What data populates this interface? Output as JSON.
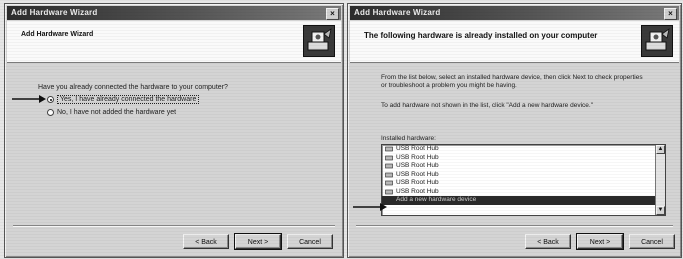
{
  "window_left": {
    "title": "Add Hardware Wizard",
    "header_text": "Add Hardware Wizard",
    "question": "Have you already connected the hardware to your computer?",
    "options": [
      {
        "label": "Yes, I have already connected the hardware",
        "selected": true
      },
      {
        "label": "No, I have not added the hardware yet",
        "selected": false
      }
    ],
    "buttons": {
      "back": "< Back",
      "next": "Next >",
      "cancel": "Cancel"
    }
  },
  "window_right": {
    "title": "Add Hardware Wizard",
    "header_title": "The following hardware is already installed on your computer",
    "instruction_1": "From the list below, select an installed hardware device, then click Next to check properties or troubleshoot a problem you might be having.",
    "instruction_2": "To add hardware not shown in the list, click \"Add a new hardware device.\"",
    "list_label": "Installed hardware:",
    "list_items": [
      "USB Root Hub",
      "USB Root Hub",
      "USB Root Hub",
      "USB Root Hub",
      "USB Root Hub",
      "USB Root Hub",
      "Add a new hardware device"
    ],
    "buttons": {
      "back": "< Back",
      "next": "Next >",
      "cancel": "Cancel"
    }
  },
  "icons": {
    "wizard": "hardware-wizard-icon",
    "pointer": "pointer-arrow-icon",
    "usb": "usb-device-icon"
  },
  "colors": {
    "titlebar": "#2c2c2c",
    "selection": "#2a2a2a",
    "dialog_face": "#d4d4d4"
  }
}
